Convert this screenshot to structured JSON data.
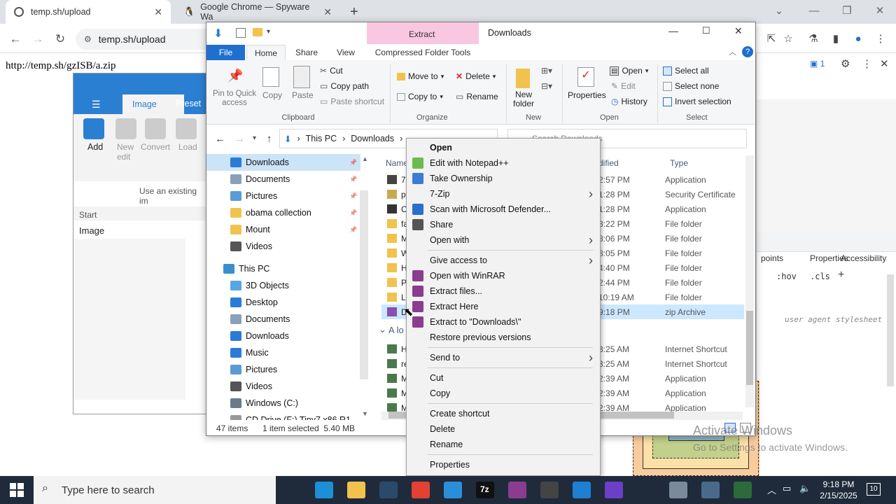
{
  "browser": {
    "tabs": [
      {
        "label": "temp.sh/upload",
        "active": true
      },
      {
        "label": "Google Chrome — Spyware Wa",
        "active": false
      }
    ],
    "url": "temp.sh/upload",
    "page_text": "http://temp.sh/gzISB/a.zip"
  },
  "bg_app": {
    "tabs": [
      "Image",
      "Preset"
    ],
    "tools": [
      "Add",
      "New edit",
      "Convert",
      "Load",
      "Co"
    ],
    "hint": "Use an existing im",
    "start_label": "Start",
    "image_label": "Image"
  },
  "devtools": {
    "badge": "1",
    "tabs": [
      "points",
      "Properties",
      "Accessibility"
    ],
    "filters": [
      ":hov",
      ".cls"
    ],
    "stylesheet_note": "user agent stylesheet"
  },
  "explorer": {
    "title": "Downloads",
    "context_tab": "Extract",
    "ribbon_tabs": [
      "File",
      "Home",
      "Share",
      "View",
      "Compressed Folder Tools"
    ],
    "clipboard": {
      "pin": "Pin to Quick access",
      "copy": "Copy",
      "paste": "Paste",
      "cut": "Cut",
      "copy_path": "Copy path",
      "paste_shortcut": "Paste shortcut",
      "group": "Clipboard"
    },
    "organize": {
      "move_to": "Move to",
      "copy_to": "Copy to",
      "delete": "Delete",
      "rename": "Rename",
      "group": "Organize"
    },
    "new": {
      "new_folder": "New folder",
      "group": "New"
    },
    "open": {
      "properties": "Properties",
      "open": "Open",
      "edit": "Edit",
      "history": "History",
      "group": "Open"
    },
    "select": {
      "all": "Select all",
      "none": "Select none",
      "invert": "Invert selection",
      "group": "Select"
    },
    "breadcrumb": [
      "This PC",
      "Downloads"
    ],
    "search_placeholder": "Search Downloads",
    "nav": [
      {
        "label": "Downloads",
        "color": "#2a7bd8",
        "pinned": true,
        "selected": true
      },
      {
        "label": "Documents",
        "color": "#8aa0b8",
        "pinned": true
      },
      {
        "label": "Pictures",
        "color": "#5b9bd5",
        "pinned": true
      },
      {
        "label": "obama collection",
        "color": "#f2c24e",
        "pinned": true
      },
      {
        "label": "Mount",
        "color": "#f2c24e",
        "pinned": true
      },
      {
        "label": "Videos",
        "color": "#555",
        "pinned": false
      },
      {
        "label": "This PC",
        "color": "#3b8ed0",
        "pinned": false
      },
      {
        "label": "3D Objects",
        "color": "#57a6e0",
        "pinned": false
      },
      {
        "label": "Desktop",
        "color": "#2a7bd8",
        "pinned": false
      },
      {
        "label": "Documents",
        "color": "#8aa0b8",
        "pinned": false
      },
      {
        "label": "Downloads",
        "color": "#2a7bd8",
        "pinned": false
      },
      {
        "label": "Music",
        "color": "#2a7bd8",
        "pinned": false
      },
      {
        "label": "Pictures",
        "color": "#5b9bd5",
        "pinned": false
      },
      {
        "label": "Videos",
        "color": "#555",
        "pinned": false
      },
      {
        "label": "Windows (C:)",
        "color": "#6a7a8a",
        "pinned": false
      },
      {
        "label": "CD Drive (F:) Tiny7 x86 R1",
        "color": "#999",
        "pinned": false
      }
    ],
    "columns": [
      "Name",
      "dified",
      "Type"
    ],
    "files": [
      {
        "name": "7",
        "date": "5 2:57 PM",
        "type": "Application",
        "color": "#444"
      },
      {
        "name": "p",
        "date": "5 1:28 PM",
        "type": "Security Certificate",
        "color": "#c9a94e"
      },
      {
        "name": "O",
        "date": "5 1:28 PM",
        "type": "Application",
        "color": "#333"
      },
      {
        "name": "fa",
        "date": "5 8:22 PM",
        "type": "File folder",
        "color": "#f2c24e"
      },
      {
        "name": "M",
        "date": "5 8:06 PM",
        "type": "File folder",
        "color": "#f2c24e"
      },
      {
        "name": "W",
        "date": "5 8:05 PM",
        "type": "File folder",
        "color": "#f2c24e"
      },
      {
        "name": "H",
        "date": "5 4:40 PM",
        "type": "File folder",
        "color": "#f2c24e"
      },
      {
        "name": "Pi",
        "date": "5 2:44 PM",
        "type": "File folder",
        "color": "#f2c24e"
      },
      {
        "name": "L",
        "date": "5 10:19 AM",
        "type": "File folder",
        "color": "#f2c24e"
      },
      {
        "name": "D",
        "date": "5 9:18 PM",
        "type": "zip Archive",
        "color": "#8a4fb3",
        "selected": true
      }
    ],
    "group2_label": "A lo",
    "files2": [
      {
        "name": "H",
        "date": "9 3:25 AM",
        "type": "Internet Shortcut"
      },
      {
        "name": "re",
        "date": "9 3:25 AM",
        "type": "Internet Shortcut"
      },
      {
        "name": "M",
        "date": "9 2:39 AM",
        "type": "Application"
      },
      {
        "name": "M",
        "date": "9 2:39 AM",
        "type": "Application"
      },
      {
        "name": "M",
        "date": "9 2:39 AM",
        "type": "Application"
      }
    ],
    "status_items": "47 items",
    "status_selected": "1 item selected  5.40 MB"
  },
  "context_menu": {
    "items": [
      {
        "label": "Open",
        "bold": true
      },
      {
        "label": "Edit with Notepad++",
        "icon": "#6dbb4e"
      },
      {
        "label": "Take Ownership",
        "icon": "#3a7bd5"
      },
      {
        "label": "7-Zip",
        "submenu": true
      },
      {
        "label": "Scan with Microsoft Defender...",
        "icon": "#2a6fc9"
      },
      {
        "label": "Share",
        "icon": "#555"
      },
      {
        "label": "Open with",
        "submenu": true
      },
      {
        "sep": true
      },
      {
        "label": "Give access to",
        "submenu": true
      },
      {
        "label": "Open with WinRAR",
        "icon": "#8a3d8f"
      },
      {
        "label": "Extract files...",
        "icon": "#8a3d8f"
      },
      {
        "label": "Extract Here",
        "icon": "#8a3d8f"
      },
      {
        "label": "Extract to \"Downloads\\\"",
        "icon": "#8a3d8f"
      },
      {
        "label": "Restore previous versions"
      },
      {
        "sep": true
      },
      {
        "label": "Send to",
        "submenu": true
      },
      {
        "sep": true
      },
      {
        "label": "Cut"
      },
      {
        "label": "Copy"
      },
      {
        "sep": true
      },
      {
        "label": "Create shortcut"
      },
      {
        "label": "Delete"
      },
      {
        "label": "Rename"
      },
      {
        "sep": true
      },
      {
        "label": "Properties"
      }
    ]
  },
  "watermark": {
    "line1": "Activate Windows",
    "line2": "Go to Settings to activate Windows."
  },
  "taskbar": {
    "search_placeholder": "Type here to search",
    "time": "9:18 PM",
    "date": "2/15/2025",
    "notif_count": "10",
    "icons": [
      {
        "name": "task-view-icon",
        "color": "#1f2b3a"
      },
      {
        "name": "edge-icon",
        "color": "#1c8fd6"
      },
      {
        "name": "file-explorer-icon",
        "color": "#f2c24e"
      },
      {
        "name": "steam-icon",
        "color": "#2a4a6a"
      },
      {
        "name": "chrome-icon",
        "color": "#e34133"
      },
      {
        "name": "app-blue-icon",
        "color": "#2a8fd8"
      },
      {
        "name": "7zip-icon",
        "color": "#111"
      },
      {
        "name": "winrar-icon",
        "color": "#8a3d8f"
      },
      {
        "name": "code-icon",
        "color": "#444"
      },
      {
        "name": "ftp-icon",
        "color": "#1e7fd3"
      },
      {
        "name": "app-purple-icon",
        "color": "#6b3fc7"
      },
      {
        "name": "settings-icon",
        "color": "#1f2b3a"
      },
      {
        "name": "vm-icon",
        "color": "#7a8a9a"
      },
      {
        "name": "wireshark-icon",
        "color": "#4a6a8a"
      },
      {
        "name": "calc-icon",
        "color": "#2b6b3b"
      }
    ],
    "seven_zip_label": "7z"
  }
}
